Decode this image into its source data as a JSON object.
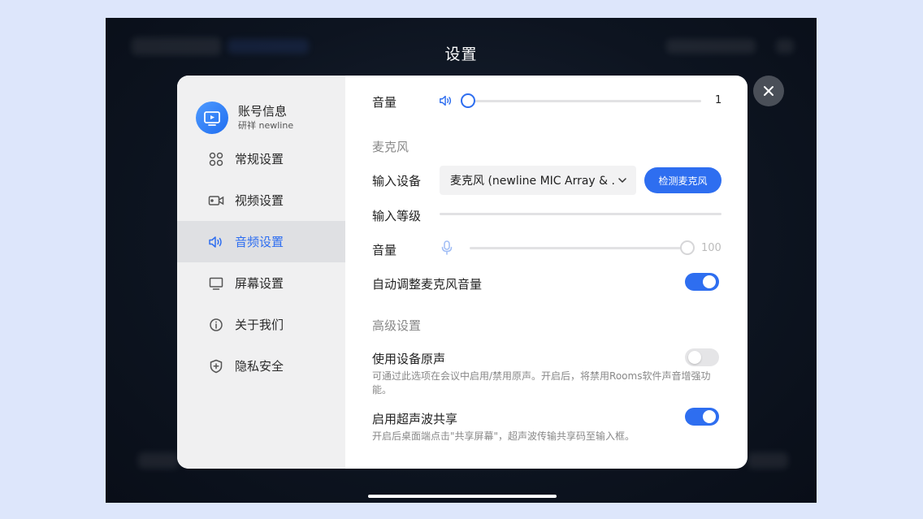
{
  "screen": {
    "title": "设置"
  },
  "sidebar": {
    "account": {
      "title": "账号信息",
      "subtitle": "研祥 newline"
    },
    "items": [
      {
        "label": "常规设置",
        "icon": "grid-icon"
      },
      {
        "label": "视频设置",
        "icon": "video-camera-icon"
      },
      {
        "label": "音频设置",
        "icon": "speaker-icon",
        "active": true
      },
      {
        "label": "屏幕设置",
        "icon": "monitor-icon"
      },
      {
        "label": "关于我们",
        "icon": "info-icon"
      },
      {
        "label": "隐私安全",
        "icon": "shield-icon"
      }
    ]
  },
  "speaker": {
    "label": "音量",
    "value": "1",
    "level": 1
  },
  "mic": {
    "section": "麦克风",
    "input_label": "输入设备",
    "device": "麦克风 (newline MIC Array & ...",
    "detect_button": "检测麦克风",
    "level_label": "输入等级",
    "volume_label": "音量",
    "volume_value": "100",
    "volume_level": 100,
    "auto_label": "自动调整麦克风音量",
    "auto_on": true
  },
  "advanced": {
    "section": "高级设置",
    "original_label": "使用设备原声",
    "original_desc": "可通过此选项在会议中启用/禁用原声。开启后，将禁用Rooms软件声音增强功能。",
    "original_on": false,
    "ultrasonic_label": "启用超声波共享",
    "ultrasonic_desc": "开启后桌面端点击\"共享屏幕\"，超声波传输共享码至输入框。",
    "ultrasonic_on": true
  },
  "colors": {
    "accent": "#2E6EF0",
    "sidebar_bg": "#F0F0F1",
    "active_bg": "#DFE0E3"
  }
}
